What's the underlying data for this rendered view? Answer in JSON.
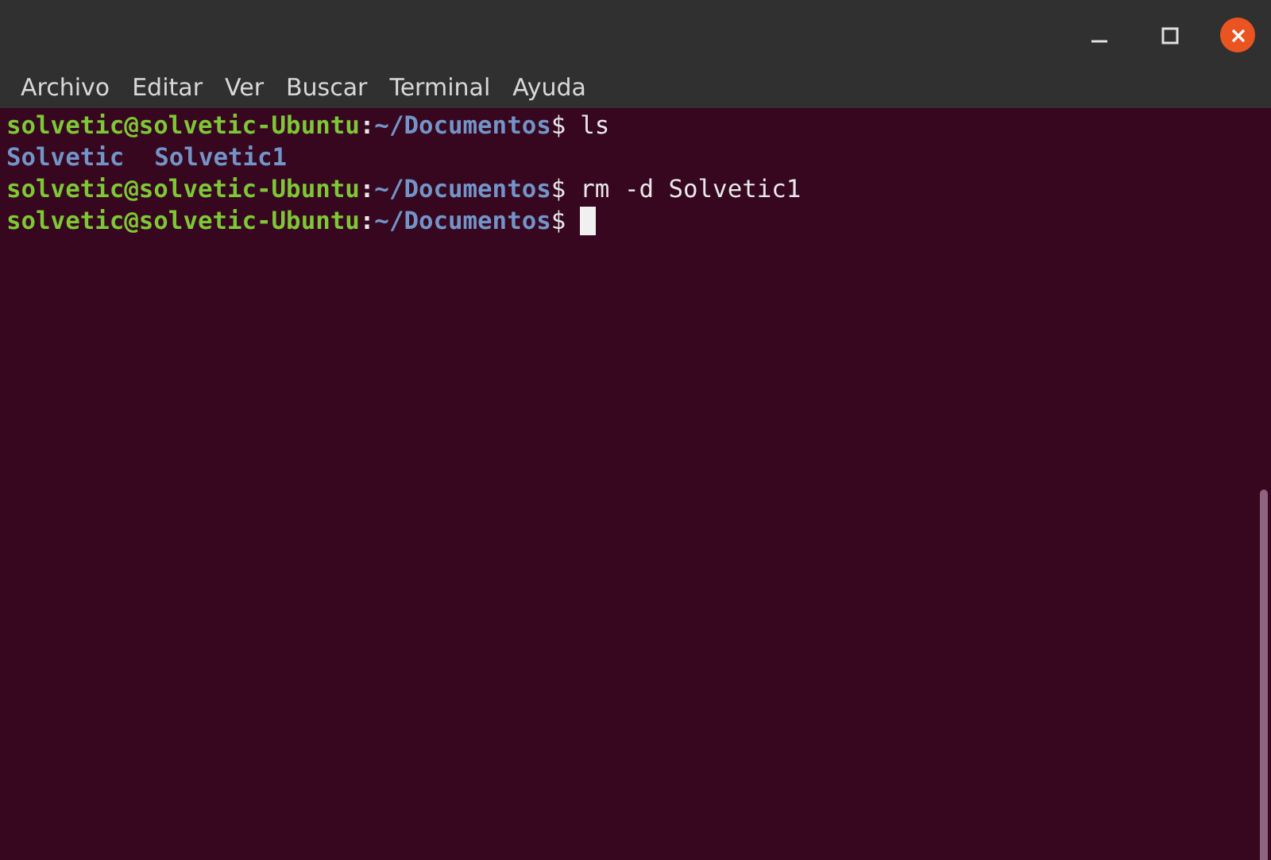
{
  "window": {
    "buttons": [
      {
        "kind": "minimize"
      },
      {
        "kind": "maximize"
      },
      {
        "kind": "close"
      }
    ]
  },
  "menu": [
    "Archivo",
    "Editar",
    "Ver",
    "Buscar",
    "Terminal",
    "Ayuda"
  ],
  "lines": [
    {
      "kind": "prompt",
      "user": "solvetic@solvetic-Ubuntu",
      "sep": ":",
      "path": "~/Documentos",
      "symbol": "$",
      "command": "ls",
      "cursor": false
    },
    {
      "kind": "output",
      "items": [
        "Solvetic",
        "Solvetic1"
      ]
    },
    {
      "kind": "prompt",
      "user": "solvetic@solvetic-Ubuntu",
      "sep": ":",
      "path": "~/Documentos",
      "symbol": "$",
      "command": "rm -d Solvetic1",
      "cursor": false
    },
    {
      "kind": "prompt",
      "user": "solvetic@solvetic-Ubuntu",
      "sep": ":",
      "path": "~/Documentos",
      "symbol": "$",
      "cursor": true
    }
  ]
}
